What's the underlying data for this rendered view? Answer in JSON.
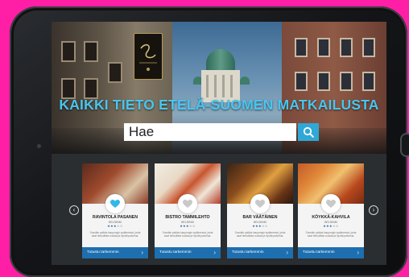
{
  "hero": {
    "headline": "KAIKKI TIETO ETELÄ-SUOMEN MATKAILUSTA",
    "sign_text": "Sea Horse"
  },
  "search": {
    "value": "Hae"
  },
  "cards": [
    {
      "name": "RAVINTOLA PASANEN",
      "city": "HELSINKI",
      "stars": "★★★☆☆",
      "desc": "Suosittu paikka kaupungin sydämessä, josta saat herkullista ruokaa ja hyvää palvelua.",
      "cta": "Tutustu tarkemmin",
      "liked": true
    },
    {
      "name": "BISTRO TAMMILEHTO",
      "city": "HELSINKI",
      "stars": "★★★☆☆",
      "desc": "Suosittu paikka kaupungin sydämessä, josta saat herkullista ruokaa ja hyvää palvelua.",
      "cta": "Tutustu tarkemmin",
      "liked": false
    },
    {
      "name": "BAR VÄÄTÄINEN",
      "city": "HELSINKI",
      "stars": "★★★☆☆",
      "desc": "Suosittu paikka kaupungin sydämessä, josta saat herkullista ruokaa ja hyvää palvelua.",
      "cta": "Tutustu tarkemmin",
      "liked": false
    },
    {
      "name": "KÖYKKÄ-KAHVILA",
      "city": "HELSINKI",
      "stars": "★★★☆☆",
      "desc": "Suosittu paikka kaupungin sydämessä, josta saat herkullista ruokaa ja hyvää palvelua.",
      "cta": "Tutustu tarkemmin",
      "liked": false
    }
  ],
  "colors": {
    "accent": "#47c6f0",
    "cta": "#1e6fb0",
    "background": "#ff1fa6"
  },
  "icons": {
    "search": "search-icon",
    "prev": "chevron-left-icon",
    "next": "chevron-right-icon",
    "heart": "heart-icon"
  }
}
